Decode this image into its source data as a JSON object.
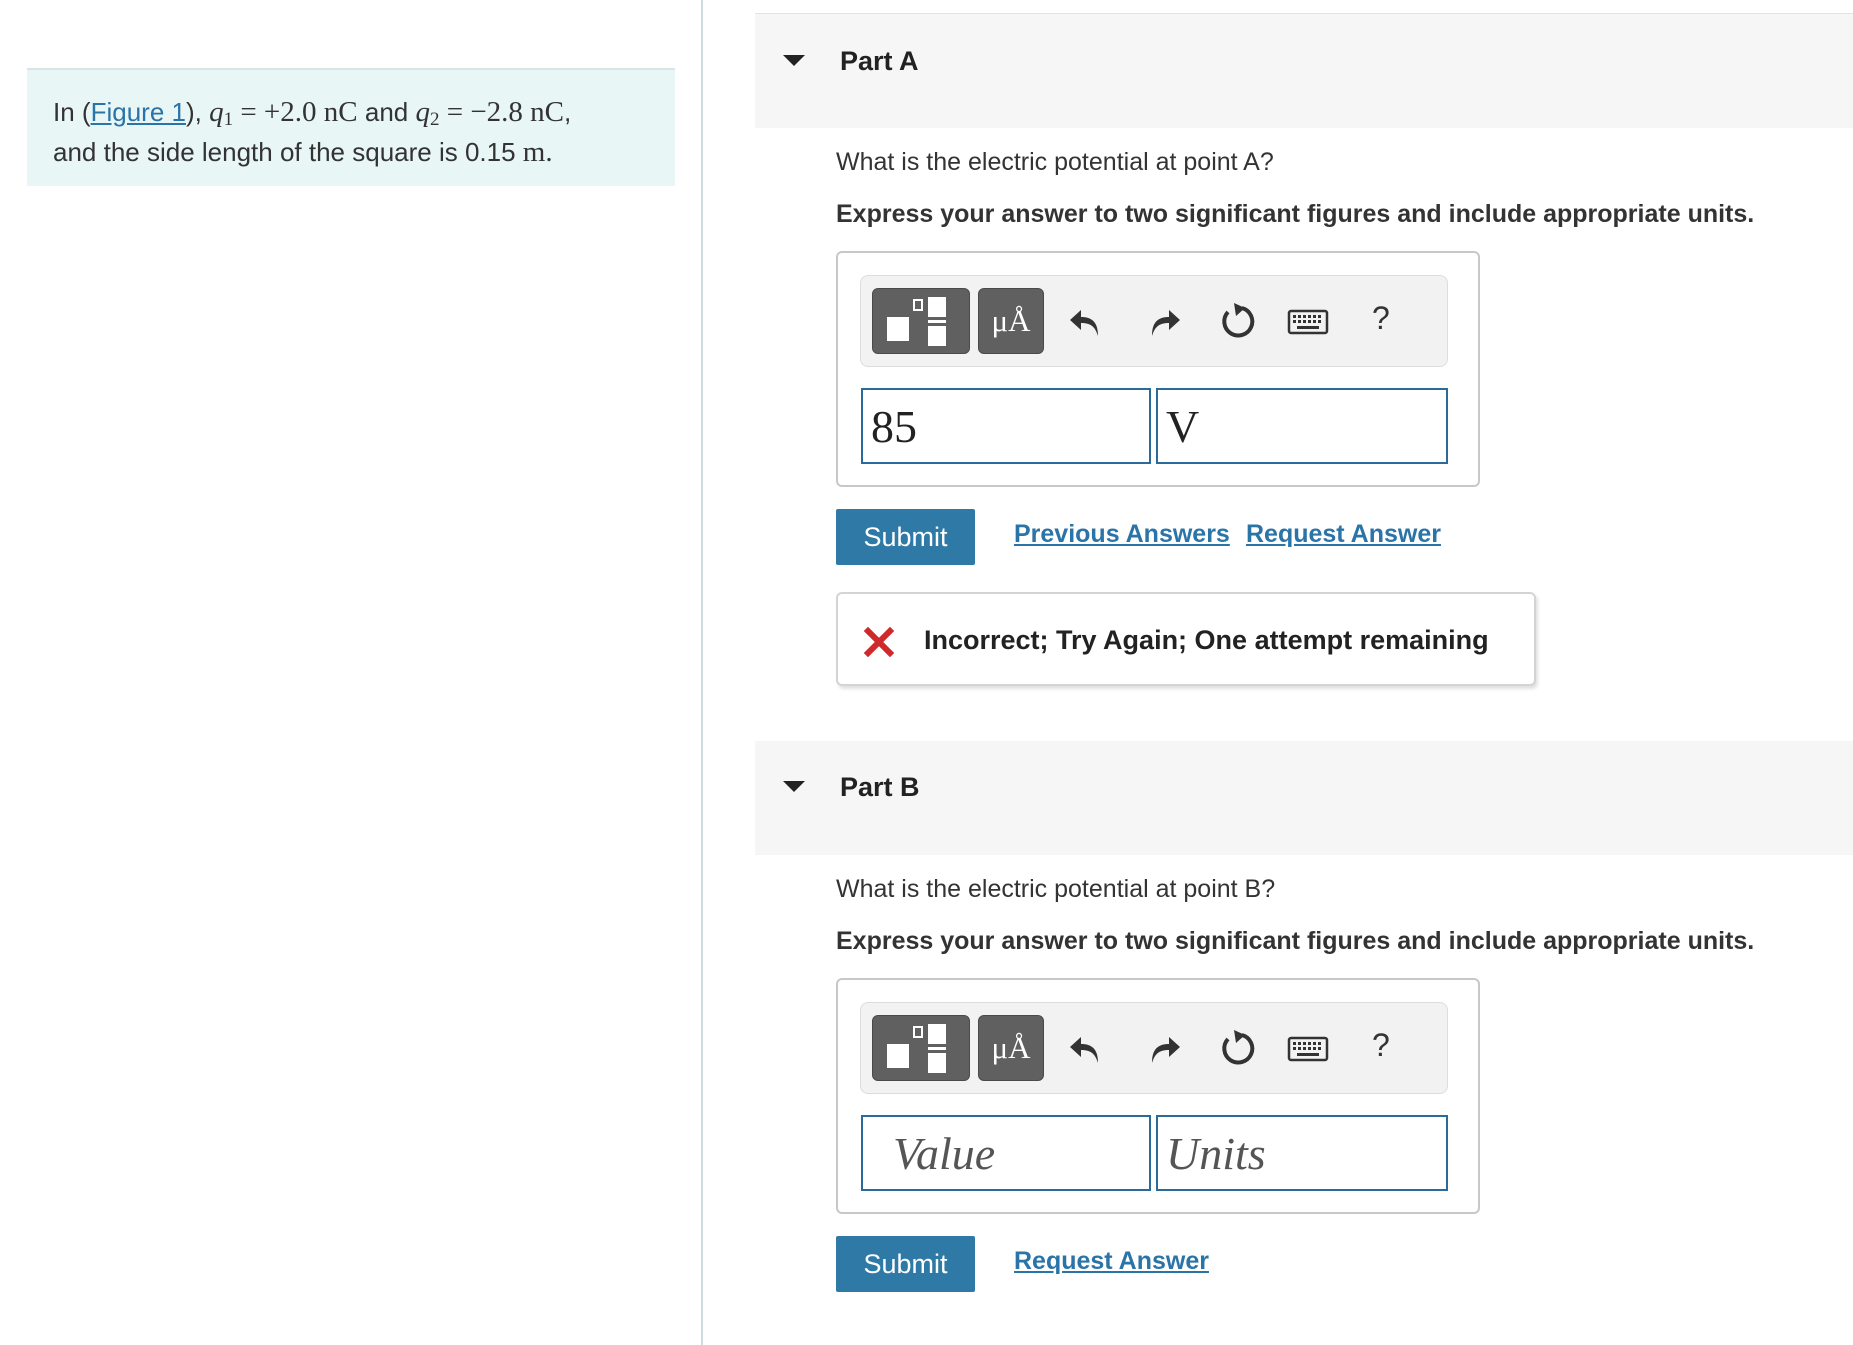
{
  "problem": {
    "prefix": "In (",
    "figure_link": "Figure 1",
    "suffix": "), ",
    "q1_symbol": "q",
    "q1_sub": "1",
    "q1_value": " = +2.0 nC",
    "and_text": " and ",
    "q2_symbol": "q",
    "q2_sub": "2",
    "q2_value": " = −2.8 nC",
    "line2_text": "and the side length of the square is 0.15 ",
    "length_unit": "m."
  },
  "part_a": {
    "title": "Part A",
    "question": "What is the electric potential at point A?",
    "instruction": "Express your answer to two significant figures and include appropriate units.",
    "toolbar": {
      "units_label": "μÅ",
      "help_label": "?"
    },
    "value": "85",
    "unit": "V",
    "submit_label": "Submit",
    "previous_answers_label": "Previous Answers",
    "request_answer_label": "Request Answer",
    "feedback": "Incorrect; Try Again; One attempt remaining"
  },
  "part_b": {
    "title": "Part B",
    "question": "What is the electric potential at point B?",
    "instruction": "Express your answer to two significant figures and include appropriate units.",
    "toolbar": {
      "units_label": "μÅ",
      "help_label": "?"
    },
    "value_placeholder": "Value",
    "unit_placeholder": "Units",
    "submit_label": "Submit",
    "request_answer_label": "Request Answer"
  },
  "colors": {
    "accent": "#2e79a5",
    "link": "#2a74a8",
    "error": "#d0292b",
    "problem_bg": "#e8f6f6"
  },
  "icons": [
    "templates-icon",
    "units-icon",
    "undo-icon",
    "redo-icon",
    "reset-icon",
    "keyboard-icon",
    "help-icon",
    "incorrect-x-icon",
    "collapse-triangle-icon"
  ]
}
